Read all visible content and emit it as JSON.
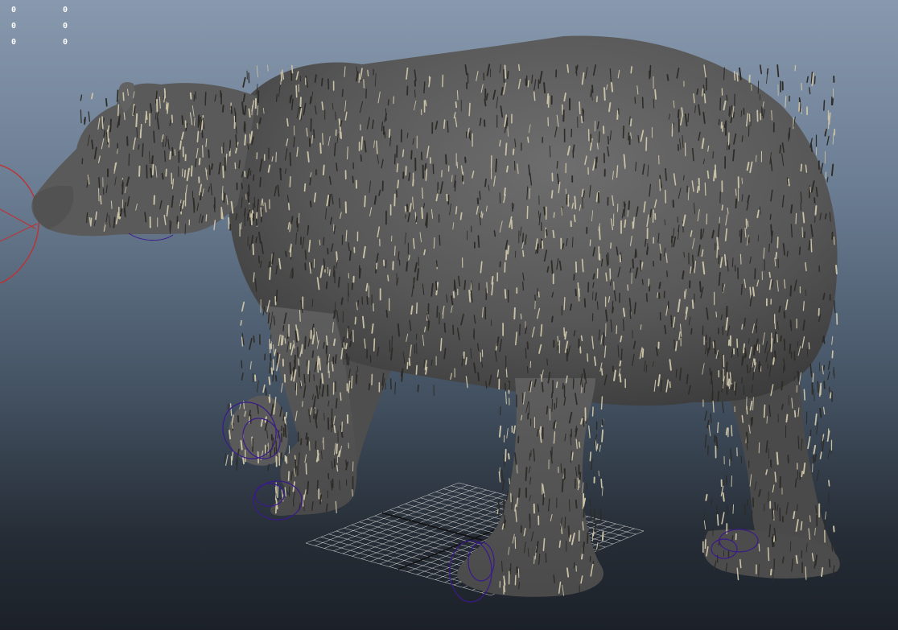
{
  "viewport": {
    "hud": {
      "rows": [
        [
          "0",
          "0"
        ],
        [
          "0",
          "0"
        ],
        [
          "0",
          "0"
        ]
      ]
    },
    "scene": {
      "subject": "bear-fur-model",
      "colors": {
        "bg_top": "#8899ae",
        "bg_bottom": "#1c2129",
        "body": "#5c5c5c",
        "fur_light": "#c9c1a6",
        "fur_dark": "#2e2c28",
        "rig_curve": "#3a1a8a",
        "camera_ring": "#c03030",
        "grid": "#d8d8d8"
      }
    }
  }
}
